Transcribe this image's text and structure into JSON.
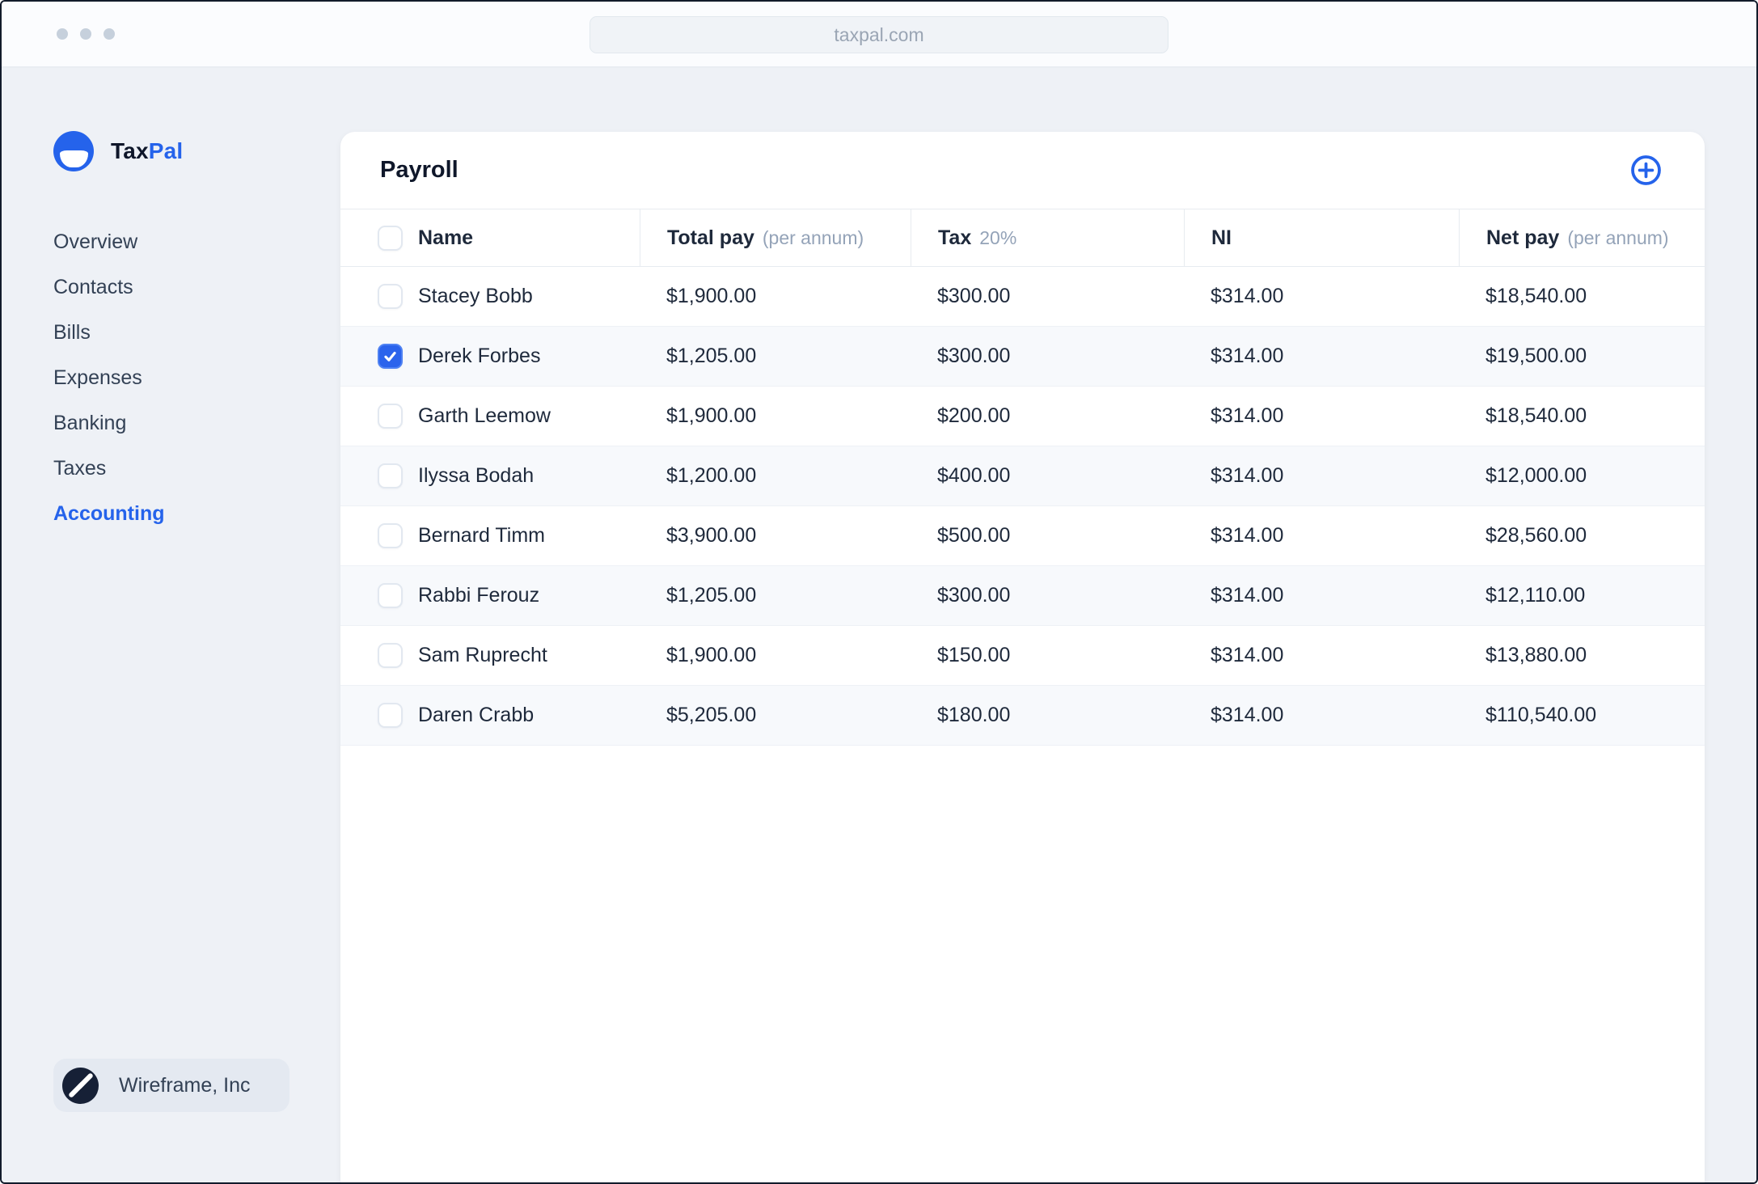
{
  "browser": {
    "url": "taxpal.com"
  },
  "brand": {
    "name_primary": "Tax",
    "name_secondary": "Pal"
  },
  "sidebar": {
    "items": [
      {
        "label": "Overview",
        "active": false
      },
      {
        "label": "Contacts",
        "active": false
      },
      {
        "label": "Bills",
        "active": false
      },
      {
        "label": "Expenses",
        "active": false
      },
      {
        "label": "Banking",
        "active": false
      },
      {
        "label": "Taxes",
        "active": false
      },
      {
        "label": "Accounting",
        "active": true
      }
    ],
    "footer": {
      "company": "Wireframe, Inc"
    }
  },
  "payroll": {
    "title": "Payroll",
    "columns": [
      {
        "label": "Name",
        "sub": ""
      },
      {
        "label": "Total pay",
        "sub": "(per annum)"
      },
      {
        "label": "Tax",
        "sub": "20%"
      },
      {
        "label": "NI",
        "sub": ""
      },
      {
        "label": "Net pay",
        "sub": "(per annum)"
      }
    ],
    "rows": [
      {
        "name": "Stacey Bobb",
        "total_pay": "$1,900.00",
        "tax": "$300.00",
        "ni": "$314.00",
        "net_pay": "$18,540.00",
        "checked": false
      },
      {
        "name": "Derek Forbes",
        "total_pay": "$1,205.00",
        "tax": "$300.00",
        "ni": "$314.00",
        "net_pay": "$19,500.00",
        "checked": true
      },
      {
        "name": "Garth Leemow",
        "total_pay": "$1,900.00",
        "tax": "$200.00",
        "ni": "$314.00",
        "net_pay": "$18,540.00",
        "checked": false
      },
      {
        "name": "Ilyssa Bodah",
        "total_pay": "$1,200.00",
        "tax": "$400.00",
        "ni": "$314.00",
        "net_pay": "$12,000.00",
        "checked": false
      },
      {
        "name": "Bernard Timm",
        "total_pay": "$3,900.00",
        "tax": "$500.00",
        "ni": "$314.00",
        "net_pay": "$28,560.00",
        "checked": false
      },
      {
        "name": "Rabbi Ferouz",
        "total_pay": "$1,205.00",
        "tax": "$300.00",
        "ni": "$314.00",
        "net_pay": "$12,110.00",
        "checked": false
      },
      {
        "name": "Sam Ruprecht",
        "total_pay": "$1,900.00",
        "tax": "$150.00",
        "ni": "$314.00",
        "net_pay": "$13,880.00",
        "checked": false
      },
      {
        "name": "Daren Crabb",
        "total_pay": "$5,205.00",
        "tax": "$180.00",
        "ni": "$314.00",
        "net_pay": "$110,540.00",
        "checked": false
      }
    ]
  },
  "colors": {
    "accent": "#2563eb",
    "text_dark": "#0f172a",
    "text_body": "#1e293b",
    "text_muted": "#94a3b8",
    "sidebar_bg": "#eef1f6",
    "card_bg": "#ffffff",
    "zebra_row": "#f7f9fc",
    "checkbox_checked": "#2b63ec"
  }
}
